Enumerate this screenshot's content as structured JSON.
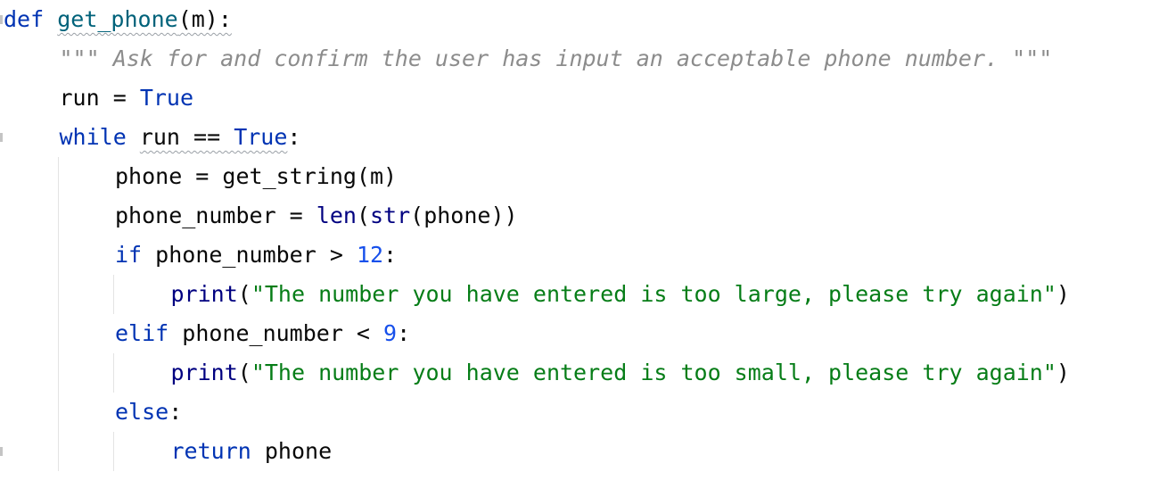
{
  "editor": {
    "language": "python",
    "lines": [
      {
        "indent": 0,
        "tokens": [
          {
            "text": "def",
            "kind": "kw"
          },
          {
            "text": " ",
            "kind": "plain"
          },
          {
            "text": "get_phone",
            "kind": "fn",
            "squiggle": true
          },
          {
            "text": "(m):",
            "kind": "plain",
            "squiggle": true
          }
        ]
      },
      {
        "indent": 1,
        "tokens": [
          {
            "text": "\"\"\" Ask for and confirm the user has input an acceptable phone number. \"\"\"",
            "kind": "doc"
          }
        ]
      },
      {
        "indent": 1,
        "tokens": [
          {
            "text": "run",
            "kind": "plain"
          },
          {
            "text": " = ",
            "kind": "plain"
          },
          {
            "text": "True",
            "kind": "kw"
          }
        ]
      },
      {
        "indent": 1,
        "tokens": [
          {
            "text": "while",
            "kind": "kw"
          },
          {
            "text": " ",
            "kind": "plain"
          },
          {
            "text": "run == ",
            "kind": "plain",
            "squiggle": true
          },
          {
            "text": "True",
            "kind": "kw",
            "squiggle": true
          },
          {
            "text": ":",
            "kind": "plain"
          }
        ]
      },
      {
        "indent": 2,
        "tokens": [
          {
            "text": "phone = get_string(m)",
            "kind": "plain"
          }
        ]
      },
      {
        "indent": 2,
        "tokens": [
          {
            "text": "phone_number = ",
            "kind": "plain"
          },
          {
            "text": "len",
            "kind": "builtin"
          },
          {
            "text": "(",
            "kind": "plain"
          },
          {
            "text": "str",
            "kind": "builtin"
          },
          {
            "text": "(phone))",
            "kind": "plain"
          }
        ]
      },
      {
        "indent": 2,
        "tokens": [
          {
            "text": "if",
            "kind": "kw"
          },
          {
            "text": " phone_number > ",
            "kind": "plain"
          },
          {
            "text": "12",
            "kind": "num"
          },
          {
            "text": ":",
            "kind": "plain"
          }
        ]
      },
      {
        "indent": 3,
        "tokens": [
          {
            "text": "print",
            "kind": "builtin"
          },
          {
            "text": "(",
            "kind": "plain"
          },
          {
            "text": "\"The number you have entered is too large, please try again\"",
            "kind": "str"
          },
          {
            "text": ")",
            "kind": "plain"
          }
        ]
      },
      {
        "indent": 2,
        "tokens": [
          {
            "text": "elif",
            "kind": "kw"
          },
          {
            "text": " phone_number < ",
            "kind": "plain"
          },
          {
            "text": "9",
            "kind": "num"
          },
          {
            "text": ":",
            "kind": "plain"
          }
        ]
      },
      {
        "indent": 3,
        "tokens": [
          {
            "text": "print",
            "kind": "builtin"
          },
          {
            "text": "(",
            "kind": "plain"
          },
          {
            "text": "\"The number you have entered is too small, please try again\"",
            "kind": "str"
          },
          {
            "text": ")",
            "kind": "plain"
          }
        ]
      },
      {
        "indent": 2,
        "tokens": [
          {
            "text": "else",
            "kind": "kw"
          },
          {
            "text": ":",
            "kind": "plain"
          }
        ]
      },
      {
        "indent": 3,
        "tokens": [
          {
            "text": "return",
            "kind": "kw"
          },
          {
            "text": " phone",
            "kind": "plain"
          }
        ]
      }
    ]
  },
  "colors": {
    "keyword": "#0033b3",
    "function": "#00627a",
    "number": "#1750eb",
    "string": "#067d17",
    "docstring": "#8c8c8c",
    "text": "#080808",
    "builtin": "#000080",
    "background": "#ffffff"
  }
}
